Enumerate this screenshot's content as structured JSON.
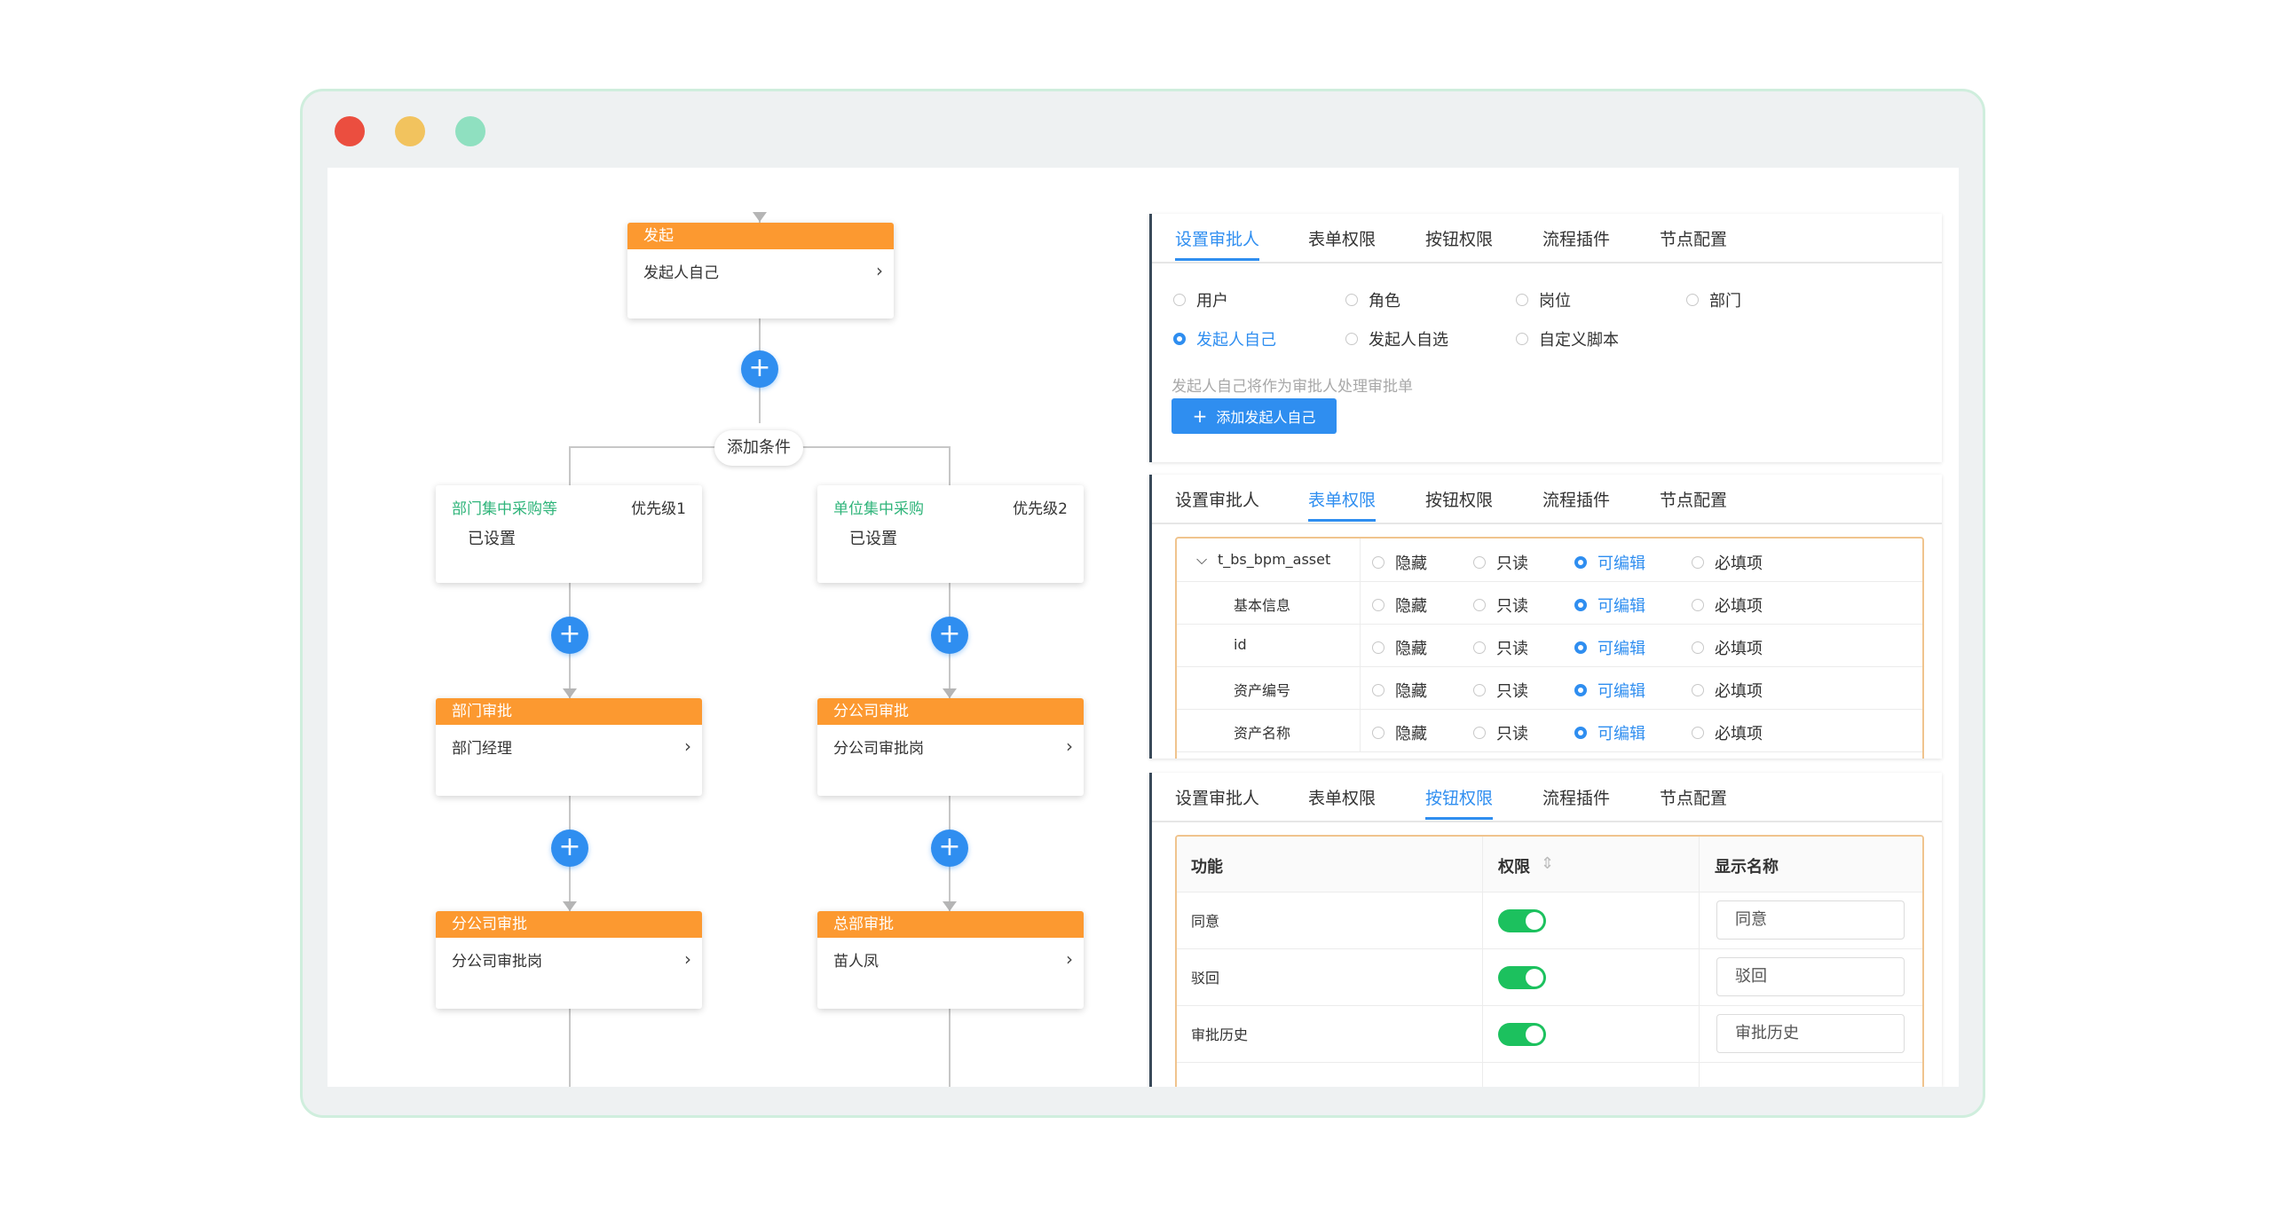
{
  "flow": {
    "start_node": {
      "header": "发起",
      "body": "发起人自己"
    },
    "add_condition": "添加条件",
    "conditions": [
      {
        "title": "部门集中采购等",
        "priority": "优先级1",
        "status": "已设置"
      },
      {
        "title": "单位集中采购",
        "priority": "优先级2",
        "status": "已设置"
      }
    ],
    "left_nodes": [
      {
        "header": "部门审批",
        "body": "部门经理"
      },
      {
        "header": "分公司审批",
        "body": "分公司审批岗"
      }
    ],
    "right_nodes": [
      {
        "header": "分公司审批",
        "body": "分公司审批岗"
      },
      {
        "header": "总部审批",
        "body": "苗人凤"
      }
    ],
    "plus": "+",
    "chevron": "›"
  },
  "tabs": [
    "设置审批人",
    "表单权限",
    "按钮权限",
    "流程插件",
    "节点配置"
  ],
  "approver_panel": {
    "options_row1": [
      "用户",
      "角色",
      "岗位",
      "部门"
    ],
    "options_row2": [
      "发起人自己",
      "发起人自选",
      "自定义脚本"
    ],
    "selected": "发起人自己",
    "hint": "发起人自己将作为审批人处理审批单",
    "add_button": "添加发起人自己",
    "add_icon": "+"
  },
  "form_panel": {
    "perm_options": [
      "隐藏",
      "只读",
      "可编辑",
      "必填项"
    ],
    "selected": "可编辑",
    "rows": [
      {
        "name": "t_bs_bpm_asset",
        "expand_icon": "⌵"
      },
      {
        "name": "基本信息"
      },
      {
        "name": "id"
      },
      {
        "name": "资产编号"
      },
      {
        "name": "资产名称"
      }
    ]
  },
  "button_panel": {
    "headers": [
      "功能",
      "权限",
      "显示名称"
    ],
    "sort_icon": "⇕",
    "rows": [
      {
        "function": "同意",
        "enabled": true,
        "display": "同意"
      },
      {
        "function": "驳回",
        "enabled": true,
        "display": "驳回"
      },
      {
        "function": "审批历史",
        "enabled": true,
        "display": "审批历史"
      }
    ]
  },
  "colors": {
    "accent": "#2f8ef0",
    "node_header": "#fc9930",
    "toggle_on": "#1cc15e",
    "condition_title": "#2fb47a",
    "window_border": "#cfeedd"
  }
}
